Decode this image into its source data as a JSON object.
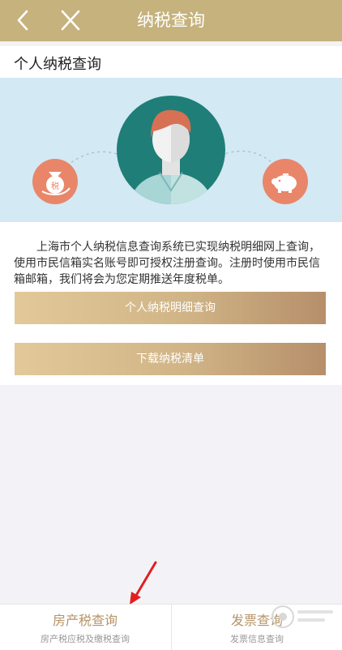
{
  "header": {
    "title": "纳税查询"
  },
  "section": {
    "title": "个人纳税查询"
  },
  "banner": {
    "badge_text": "税"
  },
  "intro": {
    "text": "上海市个人纳税信息查询系统已实现纳税明细网上查询，使用市民信箱实名账号即可授权注册查询。注册时使用市民信箱邮箱，我们将会为您定期推送年度税单。"
  },
  "buttons": {
    "detail": "个人纳税明细查询",
    "download": "下载纳税清单"
  },
  "bottom_nav": {
    "left": {
      "label": "房产税查询",
      "sub": "房产税应税及缴税查询"
    },
    "right": {
      "label": "发票查询",
      "sub": "发票信息查询"
    }
  },
  "colors": {
    "header": "#c6b27d",
    "banner_bg": "#d3e9f4",
    "avatar_circle": "#1f7e78",
    "accent_icon": "#e9866a",
    "nav_text": "#b69468",
    "arrow": "#e02020"
  },
  "icons": [
    "back-arrow-icon",
    "close-icon",
    "user-avatar-icon",
    "tax-money-bag-icon",
    "piggy-bank-icon",
    "red-arrow-annotation"
  ]
}
